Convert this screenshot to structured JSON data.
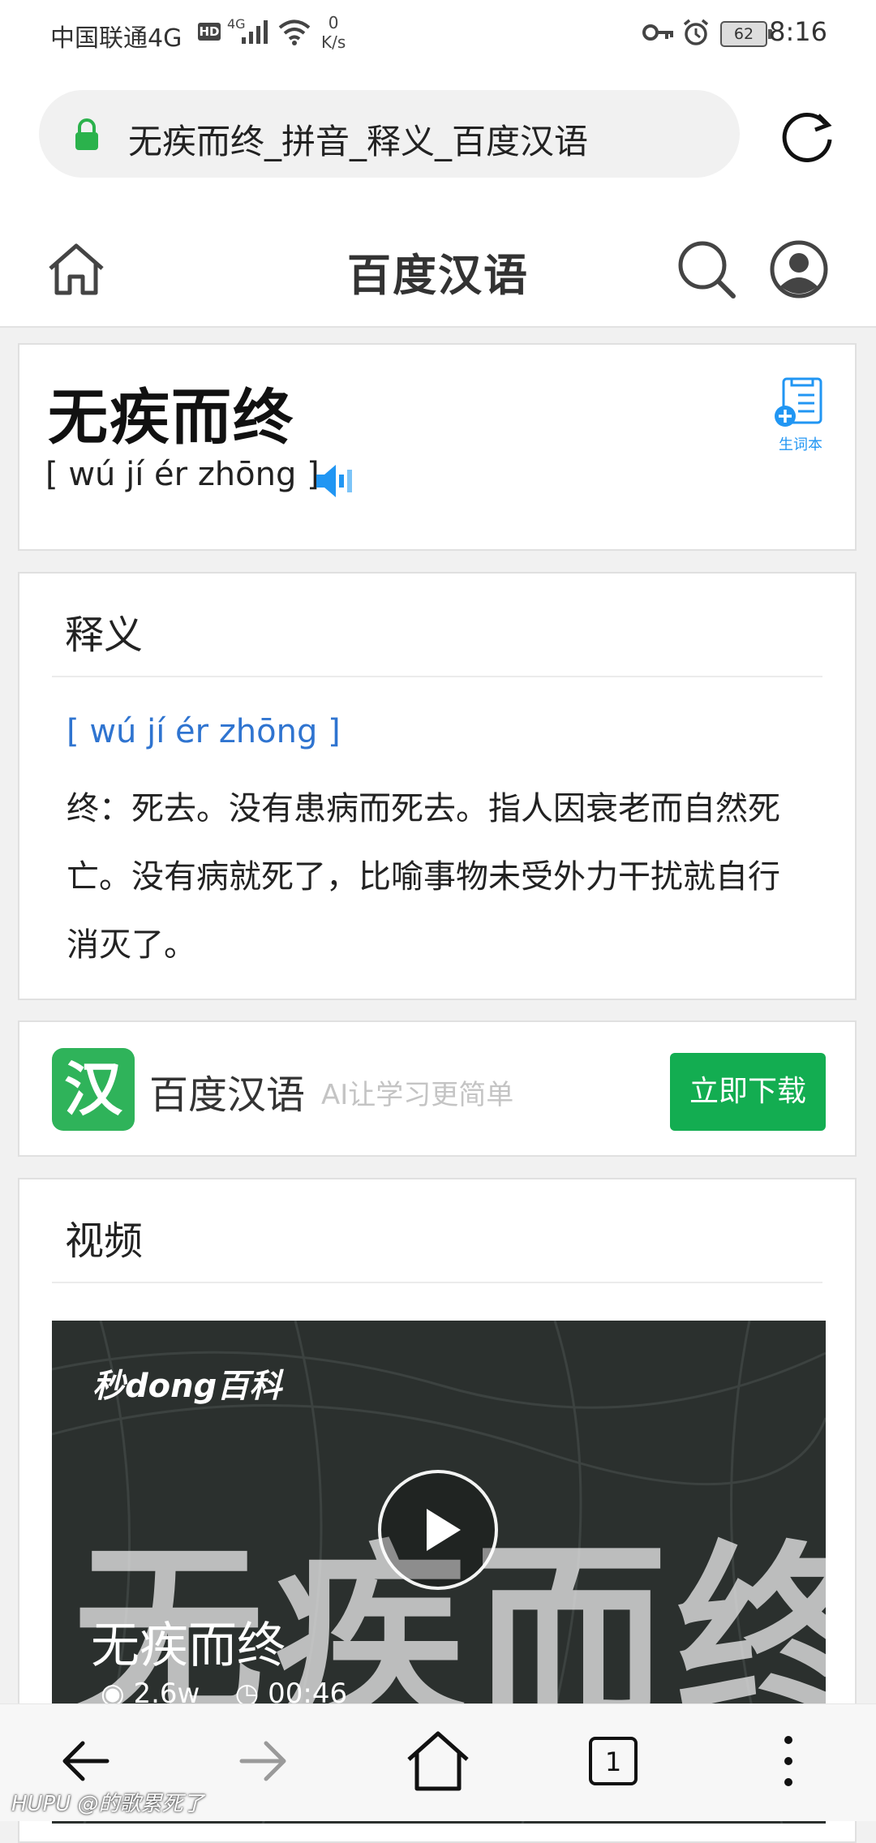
{
  "status_bar": {
    "carrier": "中国联通4G",
    "hd": "HD",
    "network": "4G",
    "speed_value": "0",
    "speed_unit": "K/s",
    "battery": "62",
    "time": "8:16"
  },
  "address_bar": {
    "page_title": "无疾而终_拼音_释义_百度汉语"
  },
  "header": {
    "brand": "百度汉语"
  },
  "word": {
    "text": "无疾而终",
    "pinyin": "[ wú jí ér zhōng ]",
    "vocab_label": "生词本"
  },
  "definition": {
    "section_title": "释义",
    "pinyin": "[ wú jí ér zhōng ]",
    "text": "终：死去。没有患病而死去。指人因衰老而自然死亡。没有病就死了，比喻事物未受外力干扰就自行消灭了。"
  },
  "app_banner": {
    "logo_char": "汉",
    "name": "百度汉语",
    "slogan": "AI让学习更简单",
    "button": "立即下载"
  },
  "video": {
    "section_title": "视频",
    "watermark": "秒dong百科",
    "big_text": "无疾而终",
    "title": "无疾而终",
    "views": "2.6w",
    "duration": "00:46"
  },
  "bottom_nav": {
    "tab_count": "1"
  },
  "overlay_watermark": "HUPU @的歌累死了",
  "colors": {
    "accent_green": "#13ad51",
    "link_blue": "#2f74d0",
    "icon_blue": "#2196f3"
  }
}
